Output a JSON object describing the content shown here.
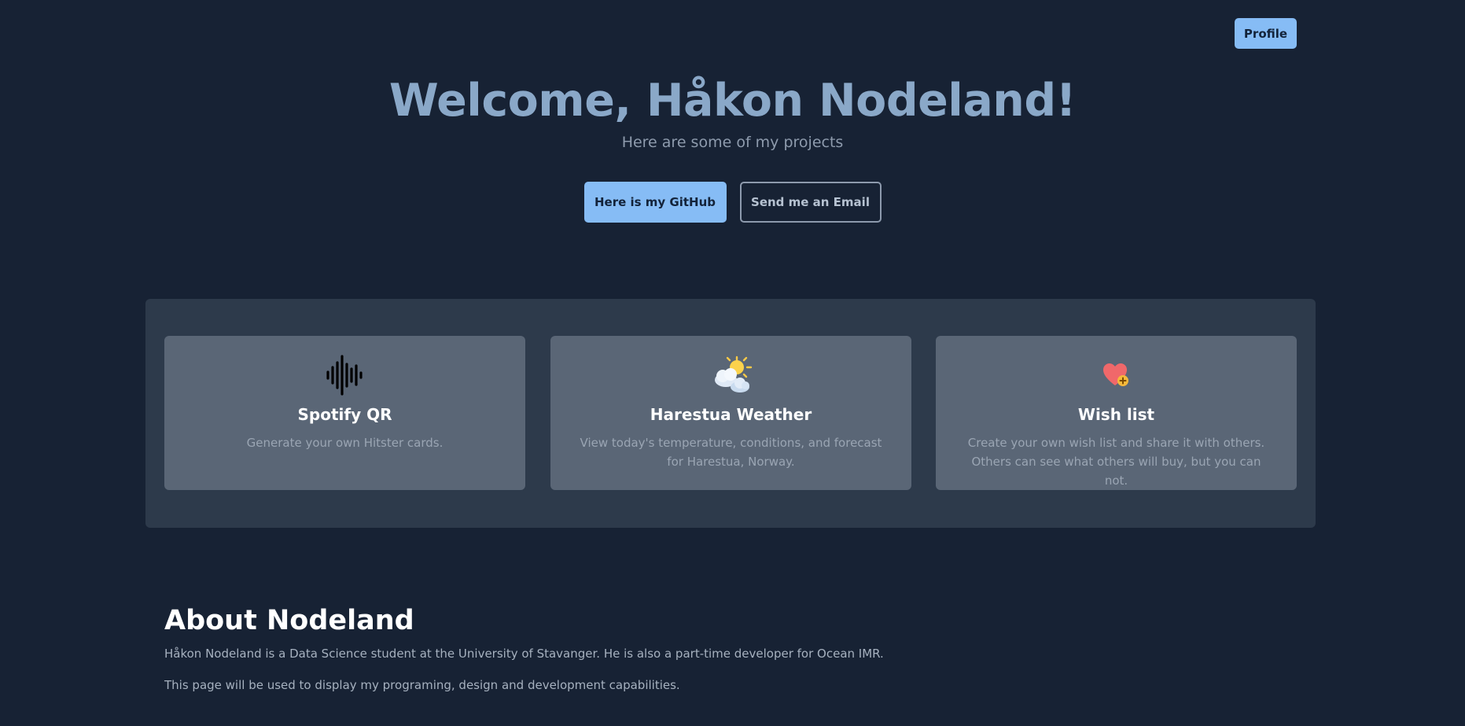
{
  "header": {
    "profile_label": "Profile"
  },
  "hero": {
    "title": "Welcome, Håkon Nodeland!",
    "subtitle": "Here are some of my projects",
    "github_label": "Here is my GitHub",
    "email_label": "Send me an Email"
  },
  "projects": [
    {
      "icon": "soundwave-icon",
      "title": "Spotify QR",
      "description": "Generate your own Hitster cards."
    },
    {
      "icon": "sun-behind-cloud-icon",
      "title": "Harestua Weather",
      "description": "View today's temperature, conditions, and forecast for Harestua, Norway."
    },
    {
      "icon": "heart-plus-icon",
      "title": "Wish list",
      "description": "Create your own wish list and share it with others. Others can see what others will buy, but you can not."
    }
  ],
  "about": {
    "title": "About Nodeland",
    "paragraph_1": "Håkon Nodeland is a Data Science student at the University of Stavanger. He is also a part-time developer for Ocean IMR.",
    "paragraph_2": "This page will be used to display my programing, design and development capabilities."
  },
  "colors": {
    "background": "#172234",
    "accent": "#86bcf5",
    "heading": "#8aa8c8",
    "panel": "#2d3a4b",
    "card": "#5a6676"
  }
}
